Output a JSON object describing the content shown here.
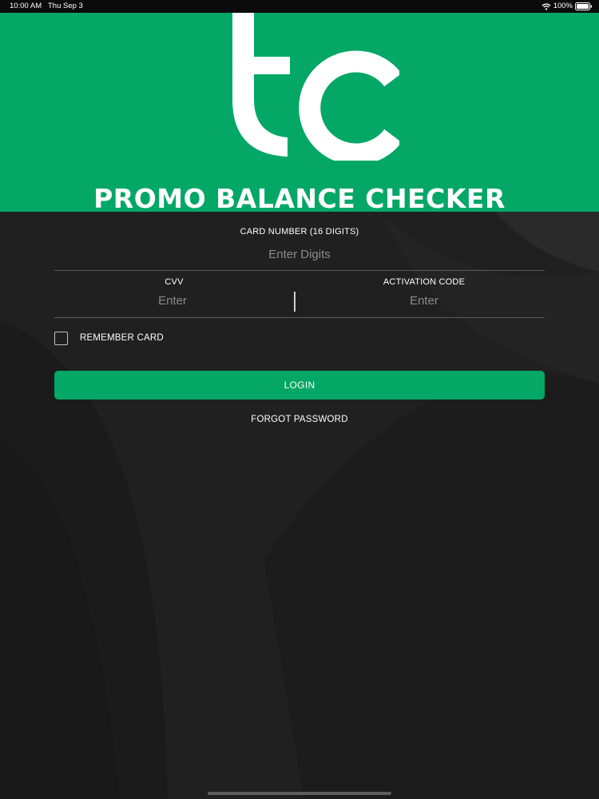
{
  "status_bar": {
    "time": "10:00 AM",
    "date": "Thu Sep 3",
    "battery": "100%"
  },
  "banner": {
    "logo_letters": "tc",
    "title": "PROMO BALANCE CHECKER",
    "background_color": "#04a766"
  },
  "form": {
    "card_number": {
      "label": "CARD NUMBER (16 DIGITS)",
      "placeholder": "Enter Digits",
      "value": ""
    },
    "cvv": {
      "label": "CVV",
      "placeholder": "Enter",
      "value": ""
    },
    "activation_code": {
      "label": "ACTIVATION CODE",
      "placeholder": "Enter",
      "value": ""
    },
    "remember_card": {
      "label": "REMEMBER CARD",
      "checked": false
    },
    "login_label": "LOGIN",
    "forgot_password_label": "FORGOT PASSWORD"
  },
  "colors": {
    "accent": "#04a766",
    "background": "#202020",
    "placeholder": "#8b8b8b",
    "divider": "#5a5a5a"
  },
  "icons": {
    "wifi": "wifi-icon",
    "battery": "battery-icon",
    "checkbox": "checkbox-icon"
  }
}
